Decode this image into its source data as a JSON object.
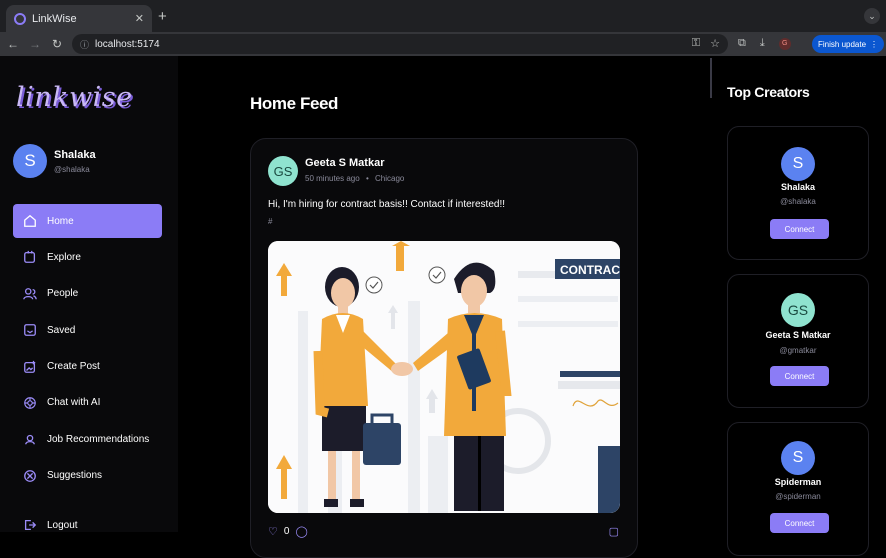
{
  "browser": {
    "tab_title": "LinkWise",
    "url": "localhost:5174",
    "update_label": "Finish update",
    "profile_initial": "G"
  },
  "sidebar": {
    "logo": "linkwise",
    "user": {
      "initial": "S",
      "name": "Shalaka",
      "handle": "@shalaka"
    },
    "items": [
      {
        "label": "Home",
        "icon": "home-icon"
      },
      {
        "label": "Explore",
        "icon": "explore-icon"
      },
      {
        "label": "People",
        "icon": "people-icon"
      },
      {
        "label": "Saved",
        "icon": "bookmark-icon"
      },
      {
        "label": "Create Post",
        "icon": "create-post-icon"
      },
      {
        "label": "Chat with AI",
        "icon": "ai-chat-icon"
      },
      {
        "label": "Job Recommendations",
        "icon": "job-icon"
      },
      {
        "label": "Suggestions",
        "icon": "suggestions-icon"
      }
    ],
    "logout_label": "Logout"
  },
  "main": {
    "title": "Home Feed",
    "post": {
      "author_initials": "GS",
      "author": "Geeta S Matkar",
      "time": "50 minutes ago",
      "separator": "•",
      "location": "Chicago",
      "text": "Hi, I'm hiring for contract basis!! Contact if interested!!",
      "tag": "#",
      "image_sign_text": "CONTRAC",
      "likes": "0"
    }
  },
  "right": {
    "title": "Top Creators",
    "creators": [
      {
        "initial": "S",
        "name": "Shalaka",
        "handle": "@shalaka",
        "button": "Connect"
      },
      {
        "initial": "GS",
        "name": "Geeta S Matkar",
        "handle": "@gmatkar",
        "button": "Connect"
      },
      {
        "initial": "S",
        "name": "Spiderman",
        "handle": "@spiderman",
        "button": "Connect"
      }
    ]
  },
  "colors": {
    "accent": "#8b7cf6",
    "avatar_blue": "#5b82f0",
    "avatar_teal": "#8fe3cf"
  }
}
